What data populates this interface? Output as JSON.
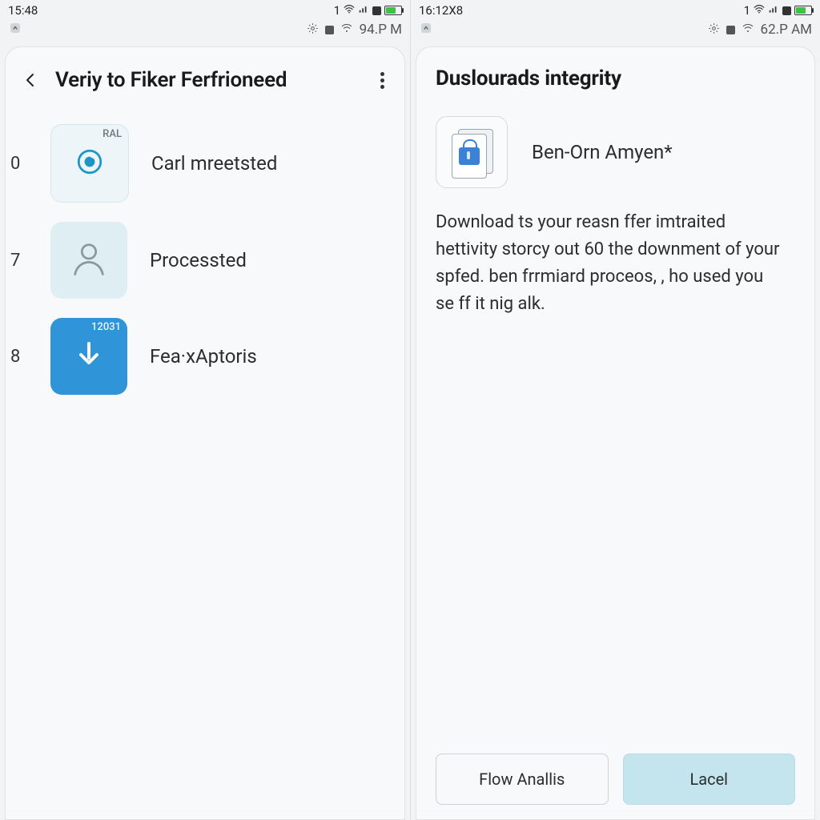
{
  "left": {
    "status": {
      "time": "15:48",
      "net": "1",
      "time2": "94.P M"
    },
    "title": "Veriy to Fiker Ferfrioneed",
    "rows": [
      {
        "num": "0",
        "tag": "RAL",
        "label": "Carl mreetsted",
        "icon": "target"
      },
      {
        "num": "7",
        "tag": "",
        "label": "Processted",
        "icon": "person"
      },
      {
        "num": "8",
        "tag": "12031",
        "label": "Fea·xAptoris",
        "icon": "download"
      }
    ]
  },
  "right": {
    "status": {
      "time": "16:12X8",
      "net": "1",
      "time2": "62.P AM"
    },
    "title": "Duslourads integrity",
    "app_name": "Ben-Orn Amyen*",
    "desc": "Download ts your reasn ffer imtraited hettivity storcy out 60 the downment of your spfed. ben frrmiard proceos, , ho used you se ff it nig alk.",
    "buttons": {
      "secondary": "Flow Anallis",
      "primary": "Lacel"
    }
  }
}
